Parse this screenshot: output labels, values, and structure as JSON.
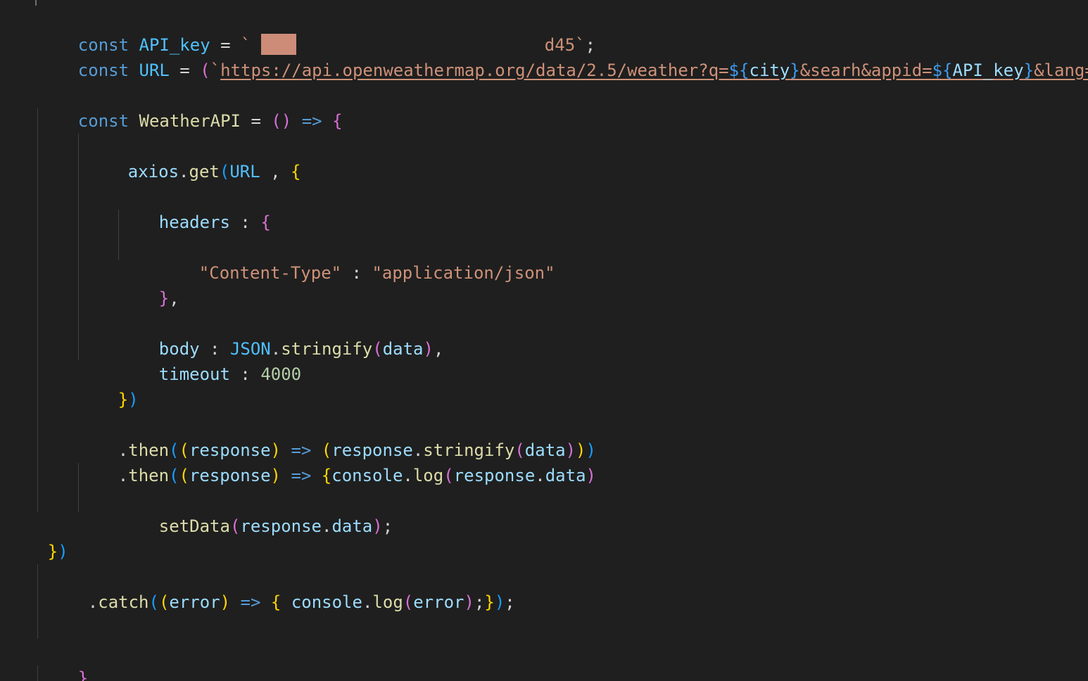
{
  "code": {
    "l1": {
      "kw": "const",
      "name": "API_key",
      "eq": " = ",
      "tick": "`",
      "tail": "d45`",
      "semi": ";"
    },
    "l2": {
      "kw": "const",
      "name": "URL",
      "eq": " = ",
      "open": "(",
      "tick": "`",
      "url_part1": "https://api.openweathermap.org/data/2.5/weather?q=",
      "tpl1_open": "${",
      "tpl1_var": "city",
      "tpl1_close": "}",
      "url_part2": "&searh&appid=",
      "tpl2_open": "${",
      "tpl2_var": "API_key",
      "tpl2_close": "}",
      "url_part3": "&lang=kr",
      "tick_end": "`"
    },
    "l3": {
      "kw": "const",
      "name": "WeatherAPI",
      "eq": " = ",
      "parens": "()",
      "arrow": " => ",
      "brace": "{"
    },
    "l4": {
      "obj": "axios",
      "dot": ".",
      "method": "get",
      "paren": "(",
      "arg": "URL",
      "comma": " , ",
      "brace": "{"
    },
    "l5": {
      "key": "headers",
      "colon": " : ",
      "brace": "{"
    },
    "l6": {
      "key": "\"Content-Type\"",
      "colon": " : ",
      "value": "\"application/json\""
    },
    "l7": {
      "brace": "}",
      "comma": ","
    },
    "l8": {
      "key": "body",
      "colon": " : ",
      "obj": "JSON",
      "dot": ".",
      "method": "stringify",
      "open": "(",
      "arg": "data",
      "close": ")",
      "comma": ","
    },
    "l9": {
      "key": "timeout",
      "colon": " : ",
      "value": "4000"
    },
    "l10": {
      "brace": "}",
      "paren": ")"
    },
    "l11": {
      "dot": ".",
      "method": "then",
      "open1": "(",
      "open2": "(",
      "param": "response",
      "close2": ")",
      "arrow": " => ",
      "open3": "(",
      "obj": "response",
      "dot2": ".",
      "method2": "stringify",
      "open4": "(",
      "arg": "data",
      "close4": ")",
      "close3": ")",
      "close1": ")"
    },
    "l12": {
      "dot": ".",
      "method": "then",
      "open1": "(",
      "open2": "(",
      "param": "response",
      "close2": ")",
      "arrow": " => ",
      "brace": "{",
      "obj": "console",
      "dot2": ".",
      "method2": "log",
      "open3": "(",
      "arg_obj": "response",
      "dot3": ".",
      "arg_prop": "data",
      "close3": ")"
    },
    "l13": {
      "fn": "setData",
      "open": "(",
      "arg_obj": "response",
      "dot": ".",
      "arg_prop": "data",
      "close": ")",
      "semi": ";"
    },
    "l14": {
      "brace": "}",
      "paren": ")"
    },
    "l15": {
      "dot": ".",
      "method": "catch",
      "open1": "(",
      "open2": "(",
      "param": "error",
      "close2": ")",
      "arrow": " => ",
      "brace": "{",
      "sp": " ",
      "obj": "console",
      "dot2": ".",
      "method2": "log",
      "open3": "(",
      "arg": "error",
      "close3": ")",
      "semi1": ";",
      "brace_close": "}",
      "close1": ")",
      "semi2": ";"
    },
    "l16": {
      "brace": "}"
    }
  },
  "colors": {
    "background": "#1f1f1f",
    "keyword": "#569cd6",
    "constant": "#4fc1ff",
    "function": "#dcdcaa",
    "variable": "#9cdcfe",
    "string": "#ce9178",
    "number": "#b5cea8",
    "bracket_gold": "#ffd700",
    "bracket_orchid": "#da70d6",
    "bracket_blue": "#179fff"
  }
}
